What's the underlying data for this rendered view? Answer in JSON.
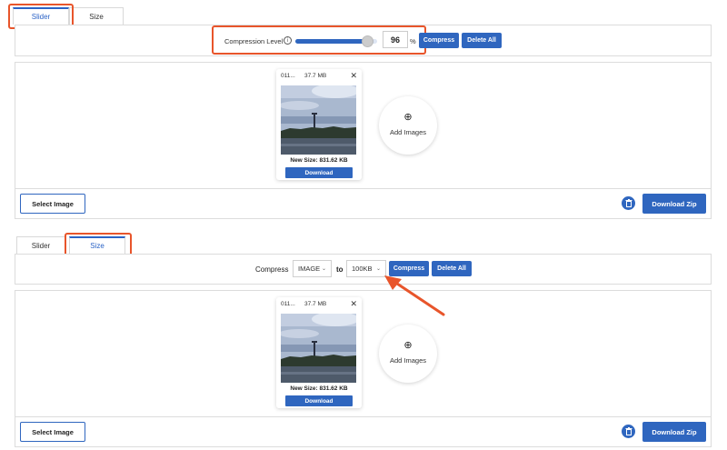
{
  "section1": {
    "tabs": [
      {
        "label": "Slider",
        "active": true
      },
      {
        "label": "Size",
        "active": false
      }
    ],
    "compression_label": "Compression Level",
    "info_icon": "info-icon",
    "slider_value_percent": 96,
    "level_value": "96",
    "percent_sign": "%",
    "compress_label": "Compress",
    "delete_all_label": "Delete All",
    "card": {
      "file_name": "011...",
      "file_size": "37.7 MB",
      "new_size": "New Size: 831.62 KB",
      "download_label": "Download"
    },
    "add_images_label": "Add Images",
    "select_image_label": "Select Image",
    "download_zip_label": "Download Zip"
  },
  "section2": {
    "tabs": [
      {
        "label": "Slider",
        "active": false
      },
      {
        "label": "Size",
        "active": true
      }
    ],
    "compress_text": "Compress",
    "type_select": "IMAGE",
    "to_text": "to",
    "size_select": "100KB",
    "compress_label": "Compress",
    "delete_all_label": "Delete All",
    "card": {
      "file_name": "011...",
      "file_size": "37.7 MB",
      "new_size": "New Size: 831.62 KB",
      "download_label": "Download"
    },
    "add_images_label": "Add Images",
    "select_image_label": "Select Image",
    "download_zip_label": "Download Zip"
  },
  "colors": {
    "accent": "#2f66bf",
    "highlight": "#e8552b"
  }
}
